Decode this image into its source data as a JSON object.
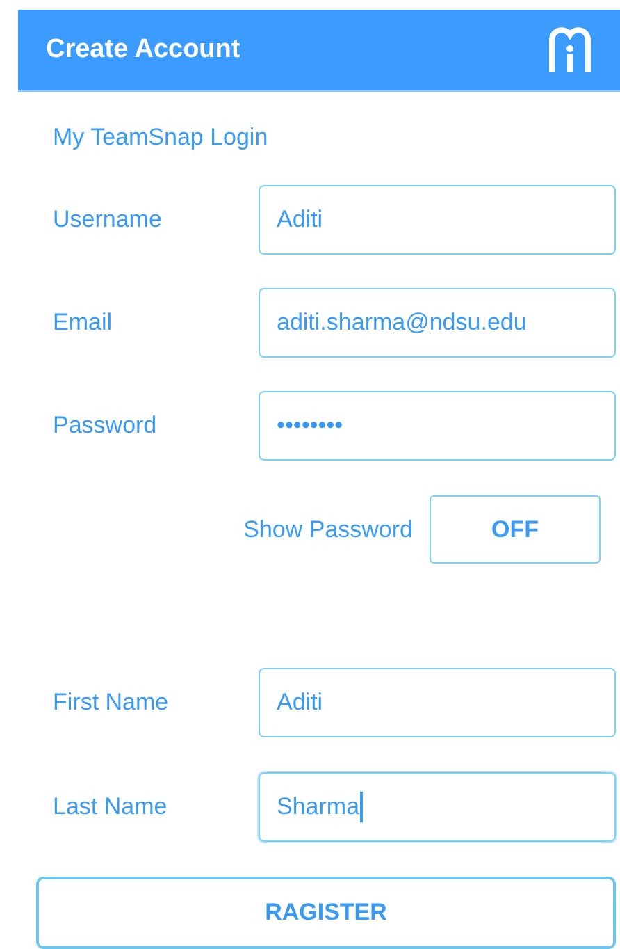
{
  "header": {
    "title": "Create Account"
  },
  "link": "My TeamSnap Login",
  "fields": [
    {
      "label": "Username",
      "value": "Aditi",
      "focused": false
    },
    {
      "label": "Email",
      "value": "aditi.sharma@ndsu.edu",
      "focused": false
    },
    {
      "label": "Password",
      "value": "••••••••",
      "focused": false
    }
  ],
  "show_password": {
    "label": "Show Password",
    "toggle": "OFF",
    "on": false
  },
  "name_fields": [
    {
      "label": "First Name",
      "value": "Aditi",
      "focused": false
    },
    {
      "label": "Last Name",
      "value": "Sharma",
      "focused": true
    }
  ],
  "button": "RAGISTER"
}
